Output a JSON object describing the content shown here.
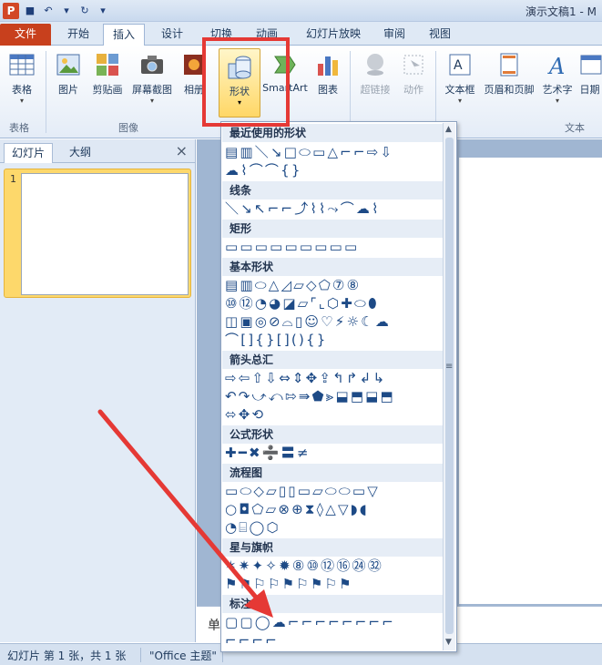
{
  "titlebar": {
    "app_letter": "P",
    "title": "演示文稿1 - M",
    "undo_glyph": "↶",
    "redo_glyph": "↻",
    "save_glyph": "■",
    "dropdown_glyph": "▾"
  },
  "tabs": {
    "file": "文件",
    "home": "开始",
    "insert": "插入",
    "design": "设计",
    "transitions": "切换",
    "animations": "动画",
    "slideshow": "幻灯片放映",
    "review": "审阅",
    "view": "视图"
  },
  "ribbon": {
    "table": "表格",
    "picture": "图片",
    "clipart": "剪贴画",
    "screenshot": "屏幕截图",
    "album": "相册",
    "shapes": "形状",
    "smartart": "SmartArt",
    "chart": "图表",
    "hyperlink": "超链接",
    "action": "动作",
    "textbox": "文本框",
    "header_footer": "页眉和页脚",
    "wordart": "艺术字",
    "datetime": "日期",
    "caret": "▾",
    "groups": {
      "tables": "表格",
      "images": "图像",
      "text": "文本"
    }
  },
  "side_panel": {
    "tab_slides": "幻灯片",
    "tab_outline": "大纲",
    "close": "×",
    "slide_number": "1"
  },
  "notes_placeholder": "单",
  "status": {
    "slide_info": "幻灯片 第 1 张，共 1 张",
    "theme": "\"Office 主题\""
  },
  "gallery": {
    "categories": {
      "recent": "最近使用的形状",
      "lines": "线条",
      "rect": "矩形",
      "basic": "基本形状",
      "arrows": "箭头总汇",
      "equation": "公式形状",
      "flowchart": "流程图",
      "stars": "星与旗帜",
      "callouts": "标注"
    },
    "rows": {
      "recent_1": "▤▥＼↘□⬭▭△⌐⌐⇨⇩",
      "recent_2": "☁⌇⌒⌒{}",
      "lines_1": "＼↘↖⌐⌐⤴⌇⌇⤳⌒☁⌇",
      "rect_1": "▭▭▭▭▭▭▭▭▭",
      "basic_1": "▤▥⬭△◿▱◇⬠⑦⑧",
      "basic_2": "⑩⑫◔◕◪▱⌜⌞⬡✚⬭⬮",
      "basic_3": "◫▣◎⊘⌓▯☺♡⚡☼☾☁",
      "basic_4": "⌒[]{}[](){}",
      "arrows_1": "⇨⇦⇧⇩⇔⇕✥⇪↰↱↲↳",
      "arrows_2": "↶↷⤻⤺⇰⇛⬟⪢⬓⬒⬓⬒",
      "arrows_3": "⬄✥⟲",
      "equation_1": "✚━✖➗〓≠",
      "flow_1": "▭⬭◇▱▯▯▭▱⬭⬭▭▽",
      "flow_2": "○◘⬠▱⊗⊕⧗◊△▽◗◖",
      "flow_3": "◔⌸◯⬡",
      "stars_1": "✶✷✦✧✹⑧⑩⑫⑯㉔㉜",
      "stars_2": "⚑⚑⚐⚐⚑⚐⚑⚐⚑",
      "callouts_1": "▢▢◯☁⌐⌐⌐⌐⌐⌐⌐⌐",
      "callouts_2": "⌐⌐⌐⌐"
    },
    "scroll_up": "▲",
    "scroll_down": "▼",
    "scroll_grip": "≡"
  },
  "colors": {
    "file_tab": "#c8401d",
    "highlight": "#e53935",
    "arrow": "#e53935",
    "ribbon_accent": "#1e395b"
  }
}
